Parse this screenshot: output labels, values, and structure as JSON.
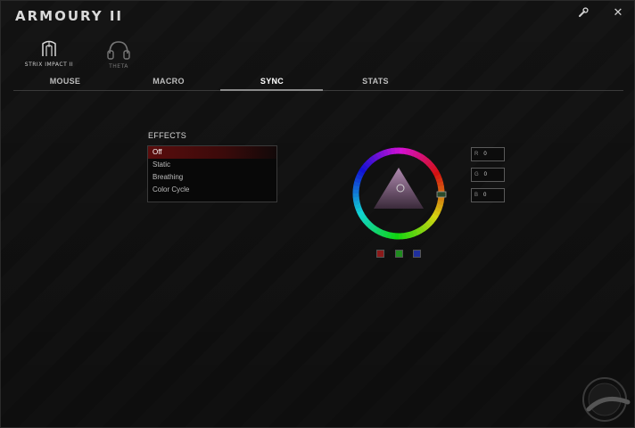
{
  "app": {
    "title": "ARMOURY II"
  },
  "window_controls": {
    "settings_icon": "wrench-icon",
    "close_icon": "close-icon",
    "close_glyph": "✕",
    "settings_glyph": "🔧"
  },
  "devices": [
    {
      "label": "STRIX IMPACT II",
      "icon": "mouse-device-icon",
      "active": true
    },
    {
      "label": "THETA",
      "icon": "headset-device-icon",
      "active": false
    }
  ],
  "tabs": [
    {
      "label": "MOUSE",
      "active": false
    },
    {
      "label": "MACRO",
      "active": false
    },
    {
      "label": "SYNC",
      "active": true
    },
    {
      "label": "STATS",
      "active": false
    }
  ],
  "effects": {
    "title": "EFFECTS",
    "items": [
      {
        "label": "Off",
        "selected": true
      },
      {
        "label": "Static",
        "selected": false
      },
      {
        "label": "Breathing",
        "selected": false
      },
      {
        "label": "Color Cycle",
        "selected": false
      }
    ]
  },
  "color_picker": {
    "r_label": "R",
    "r_value": "0",
    "g_label": "G",
    "g_value": "0",
    "b_label": "B",
    "b_value": "0",
    "presets": [
      "#8b1a1a",
      "#1f8b1f",
      "#1f2f9b"
    ]
  }
}
